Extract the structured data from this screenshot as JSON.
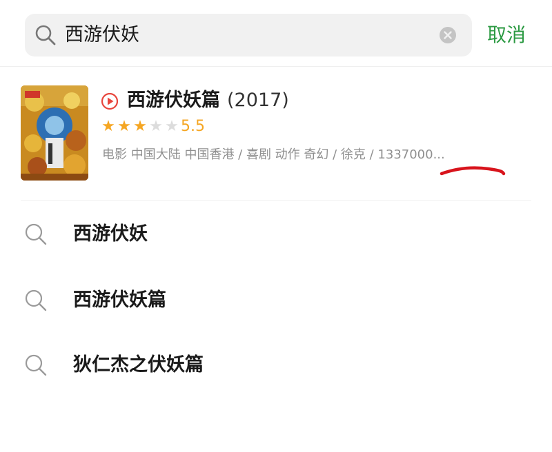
{
  "search": {
    "query": "西游伏妖",
    "cancel_label": "取消"
  },
  "movie": {
    "title": "西游伏妖篇",
    "year": "(2017)",
    "stars_filled": 3,
    "stars_total": 5,
    "rating": "5.5",
    "meta": "电影  中国大陆 中国香港 / 喜剧 动作 奇幻 / 徐克 / 1337000..."
  },
  "suggestions": [
    {
      "label": "西游伏妖"
    },
    {
      "label": "西游伏妖篇"
    },
    {
      "label": "狄仁杰之伏妖篇"
    }
  ],
  "colors": {
    "accent_green": "#2c9a43",
    "star_orange": "#f5a623",
    "play_red": "#e8453c",
    "annotation_red": "#d8141c"
  }
}
